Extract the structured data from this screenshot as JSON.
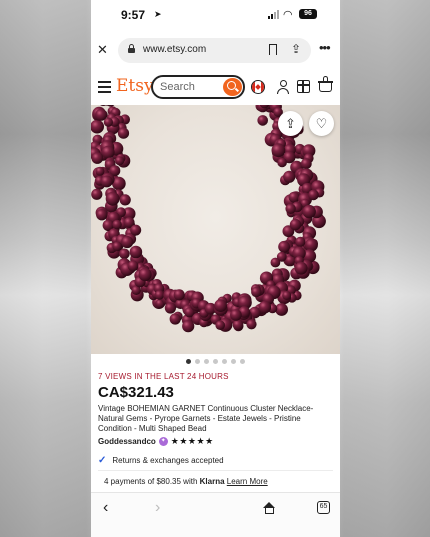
{
  "status_bar": {
    "time": "9:57",
    "battery": "96"
  },
  "browser": {
    "url": "www.etsy.com"
  },
  "header": {
    "logo": "Etsy",
    "search_placeholder": "Search"
  },
  "gallery": {
    "dot_count": 7,
    "active_index": 0
  },
  "listing": {
    "views": "7 VIEWS IN THE LAST 24 HOURS",
    "price": "CA$321.43",
    "title": "Vintage BOHEMIAN GARNET Continuous Cluster Necklace- Natural Gems - Pyrope Garnets - Estate Jewels - Pristine Condition - Multi Shaped Bead",
    "shop_name": "Goddessandco",
    "rating_stars": "★★★★★",
    "rating": 5,
    "returns": "Returns & exchanges accepted",
    "klarna_prefix": "4 payments of $80.35 with",
    "klarna_brand": "Klarna",
    "klarna_link": "Learn More"
  },
  "bottom_nav": {
    "tab_count": "65"
  },
  "colors": {
    "etsy_orange": "#f1641e",
    "views_red": "#a61a2e",
    "garnet": "#5e1a30"
  }
}
